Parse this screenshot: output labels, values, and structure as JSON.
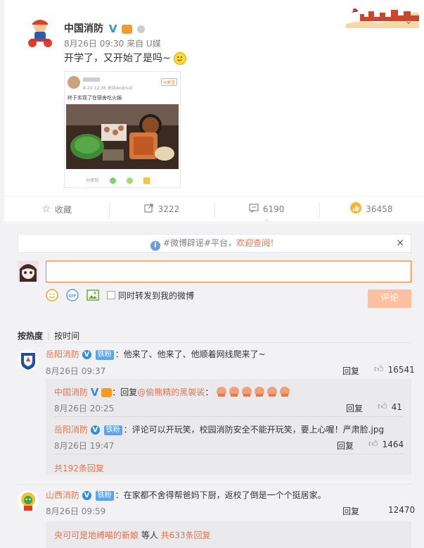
{
  "post": {
    "author": "中国消防",
    "time_source": "8月26日 09:30 来自 U媒",
    "text": "开学了，又开始了是吗~",
    "shot_meta": "8-24 12:36 来自Android",
    "shot_follow": "+关注",
    "shot_text": "终于实现了在宿舍吃火锅",
    "shot_footer": "分享到"
  },
  "actions": {
    "favorite": "收藏",
    "repost": "3222",
    "comment": "6190",
    "like": "36458"
  },
  "notice": {
    "prefix": "#微博辟谣#平台，",
    "highlight": "欢迎查阅！",
    "close": "×"
  },
  "composer": {
    "repost_label": "同时转发到我的微博",
    "submit": "评论"
  },
  "sort": {
    "hot": "按热度",
    "time": "按时间"
  },
  "comments": [
    {
      "user": "岳阳消防",
      "fan": "铁粉",
      "text": "：他来了、他来了、他顺着网线爬来了~",
      "time": "8月26日 09:37",
      "reply": "回复",
      "likes": "16541",
      "replies": [
        {
          "user": "中国消防",
          "prefix": "：回复",
          "mention": "@偷熊精的黑袈裟",
          "suffix": "：",
          "time": "8月26日 20:25",
          "reply": "回复",
          "likes": "41"
        },
        {
          "user": "岳阳消防",
          "fan": "铁粉",
          "text": "：评论可以开玩笑，校园消防安全不能开玩笑，要上心喔！严肃脸.jpg",
          "time": "8月26日 19:47",
          "reply": "回复",
          "likes": "1464"
        }
      ],
      "more": "共192条回复"
    },
    {
      "user": "山西消防",
      "fan": "铁粉",
      "text": "：在家都不舍得帮爸妈下厨，返校了倒是一个个挺居家。",
      "time": "8月26日 09:59",
      "reply": "回复",
      "likes": "12470",
      "more_user": "央可可是地缚喵的新娘",
      "more_mid": " 等人 ",
      "more_count": "共633条回复"
    }
  ],
  "colors": {
    "accent": "#eb7350",
    "verified": "#2d8fe1",
    "fan_badge": "#5da6ee",
    "submit_disabled": "#ffc09f"
  }
}
